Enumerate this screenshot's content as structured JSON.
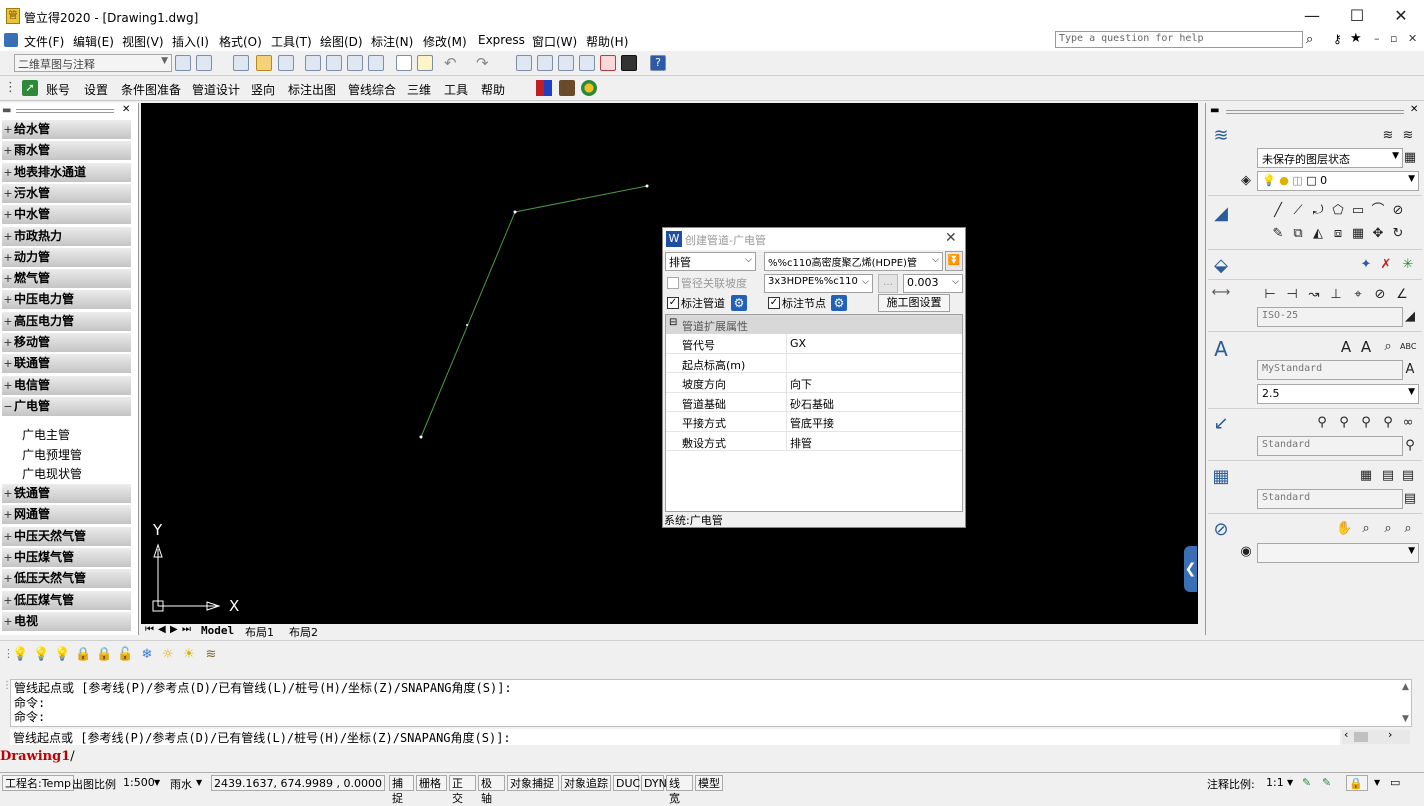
{
  "window": {
    "title": "管立得2020 - [Drawing1.dwg]",
    "min": "—",
    "max": "☐",
    "close": "✕"
  },
  "menus": [
    "文件(F)",
    "编辑(E)",
    "视图(V)",
    "插入(I)",
    "格式(O)",
    "工具(T)",
    "绘图(D)",
    "标注(N)",
    "修改(M)",
    "Express",
    "窗口(W)",
    "帮助(H)"
  ],
  "help_search": {
    "placeholder": "Type a question for help"
  },
  "workspace": "二维草图与注释",
  "toolbar2": [
    "账号",
    "设置",
    "条件图准备",
    "管道设计",
    "竖向",
    "标注出图",
    "管线综合",
    "三维",
    "工具",
    "帮助"
  ],
  "left_panel": {
    "categories_top": [
      "给水管",
      "雨水管",
      "地表排水通道",
      "污水管",
      "中水管",
      "市政热力",
      "动力管",
      "燃气管",
      "中压电力管",
      "高压电力管",
      "移动管",
      "联通管",
      "电信管",
      "广电管"
    ],
    "sub_items": [
      "广电主管",
      "广电预埋管",
      "广电现状管"
    ],
    "categories_bottom": [
      "铁通管",
      "网通管",
      "中压天然气管",
      "中压煤气管",
      "低压天然气管",
      "低压煤气管",
      "电视"
    ]
  },
  "canvas": {
    "ucs_y": "Y",
    "ucs_x": "X"
  },
  "layout_tabs": [
    "Model",
    "布局1",
    "布局2"
  ],
  "dialog": {
    "title": "创建管道-广电管",
    "type_value": "排管",
    "material_value": "%%c110高密度聚乙烯(HDPE)管",
    "slope_label": "管径关联坡度",
    "size_value": "3x3HDPE%%c110",
    "slope_value": "0.003",
    "label_pipe": "标注管道",
    "label_node": "标注节点",
    "settings_btn": "施工图设置",
    "section_title": "管道扩展属性",
    "props": [
      {
        "key": "管代号",
        "value": "GX"
      },
      {
        "key": "起点标高(m)",
        "value": ""
      },
      {
        "key": "坡度方向",
        "value": "向下"
      },
      {
        "key": "管道基础",
        "value": "砂石基础"
      },
      {
        "key": "平接方式",
        "value": "管底平接"
      },
      {
        "key": "敷设方式",
        "value": "排管"
      }
    ],
    "status": "系统:广电管"
  },
  "right_panel": {
    "layer_state": "未保存的图层状态",
    "layer_current": "0",
    "dim_style": "ISO-25",
    "text_style": "MyStandard",
    "text_height": "2.5",
    "mleader_style": "Standard",
    "table_style": "Standard"
  },
  "command": {
    "history": [
      "管线起点或 [参考线(P)/参考点(D)/已有管线(L)/桩号(H)/坐标(Z)/SNAPANG角度(S)]:",
      "命令:",
      "命令:"
    ],
    "current": "管线起点或 [参考线(P)/参考点(D)/已有管线(L)/桩号(H)/坐标(Z)/SNAPANG角度(S)]:"
  },
  "drawing_tab": "Drawing1",
  "status_bar": {
    "project": "工程名:Temp",
    "scale_label": "出图比例",
    "scale_value": "1:500",
    "system": "雨水",
    "coords": "2439.1637, 674.9989 , 0.0000",
    "toggles": [
      "捕捉",
      "栅格",
      "正交",
      "极轴",
      "对象捕捉",
      "对象追踪",
      "DUCS",
      "DYN",
      "线宽",
      "模型"
    ],
    "anno_label": "注释比例:",
    "anno_value": "1:1"
  }
}
